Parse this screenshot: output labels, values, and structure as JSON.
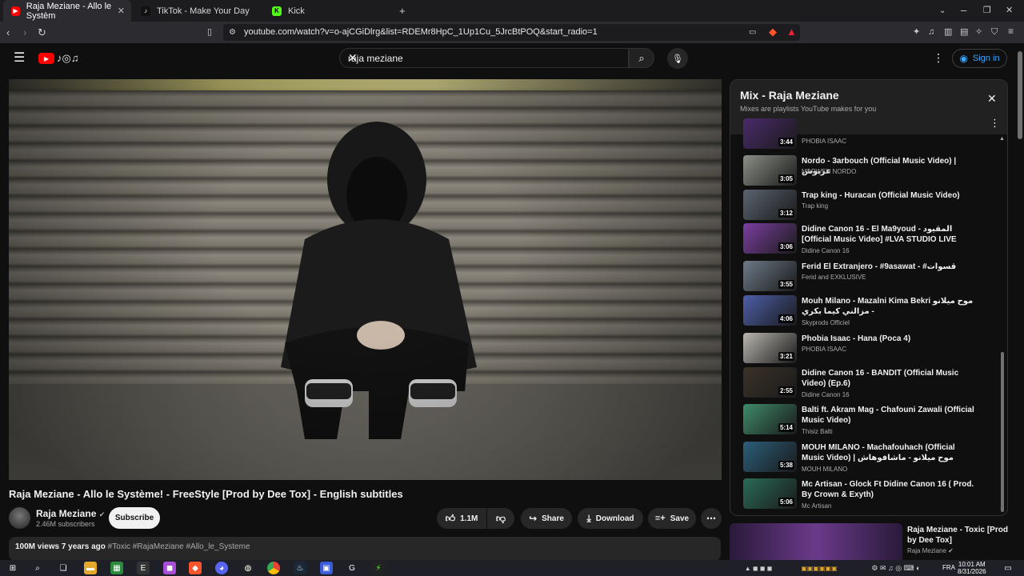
{
  "browser": {
    "tabs": [
      {
        "label": "Raja Meziane - Allo le Systèm"
      },
      {
        "label": "TikTok - Make Your Day"
      },
      {
        "label": "Kick"
      }
    ],
    "url": "youtube.com/watch?v=o-ajCGiDlrg&list=RDEMr8HpC_1Up1Cu_5JrcBtPOQ&start_radio=1"
  },
  "header": {
    "search_value": "raja meziane",
    "signin_label": "Sign in"
  },
  "video": {
    "title": "Raja Meziane - Allo le Système! - FreeStyle [Prod by Dee Tox] - English subtitles",
    "channel": "Raja Meziane",
    "subscribers": "2.46M subscribers",
    "subscribe_label": "Subscribe",
    "likes": "1.1M",
    "share_label": "Share",
    "download_label": "Download",
    "save_label": "Save",
    "views_age": "100M views  7 years ago",
    "tags": "#Toxic #RajaMeziane #Allo_le_Systeme"
  },
  "playlist": {
    "title": "Mix - Raja Meziane",
    "subtitle": "Mixes are playlists YouTube makes for you",
    "items": [
      {
        "title": "",
        "artist": "PHOBIA ISAAC",
        "duration": "3:44",
        "color": "#4a2b6b"
      },
      {
        "title": "Nordo - 3arbouch (Official Music Video) | عربوش",
        "artist": "MARWEN NORDO",
        "duration": "3:05",
        "color": "#8a8f86"
      },
      {
        "title": "Trap king - Huracan (Official Music Video)",
        "artist": "Trap king",
        "duration": "3:12",
        "color": "#5a6470"
      },
      {
        "title": "Didine Canon 16 - El Ma9youd - المقيود [Official Music Video] #LVA STUDIO LIVE",
        "artist": "Didine Canon 16",
        "duration": "3:06",
        "color": "#7b3fa0"
      },
      {
        "title": "Ferid El Extranjero - #9asawat - #قسوات",
        "artist": "Ferid and EXKLUSIVE",
        "duration": "3:55",
        "color": "#6c7a88"
      },
      {
        "title": "Mouh Milano - Mazalni Kima Bekri موح ميلانو - مزالني كيما بكري",
        "artist": "Skyprods Officiel",
        "duration": "4:06",
        "color": "#4d5fa8"
      },
      {
        "title": "Phobia Isaac - Hana (Poca 4)",
        "artist": "PHOBIA ISAAC",
        "duration": "3:21",
        "color": "#b9b6b0"
      },
      {
        "title": "Didine Canon 16 - BANDIT (Official Music Video) (Ep.6)",
        "artist": "Didine Canon 16",
        "duration": "2:55",
        "color": "#3a3228"
      },
      {
        "title": "Balti ft. Akram Mag - Chafouni Zawali (Official Music Video)",
        "artist": "Thisiz Balti",
        "duration": "5:14",
        "color": "#3f8a6a"
      },
      {
        "title": "MOUH MILANO - Machafouhach (Official Music Video) | موح ميلانو - ماشافوهاش",
        "artist": "MOUH MILANO",
        "duration": "5:38",
        "color": "#2b5e7a"
      },
      {
        "title": "Mc Artisan - Glock Ft Didine Canon 16 ( Prod. By Crown & Exyth)",
        "artist": "Mc Artisan",
        "duration": "5:06",
        "color": "#2a6b58"
      }
    ]
  },
  "next_video": {
    "title": "Raja Meziane - Toxic [Prod by Dee Tox]",
    "channel": "Raja Meziane"
  },
  "taskbar": {
    "language": "FRA",
    "time": "10:01 AM",
    "date": "8/31/2026"
  }
}
